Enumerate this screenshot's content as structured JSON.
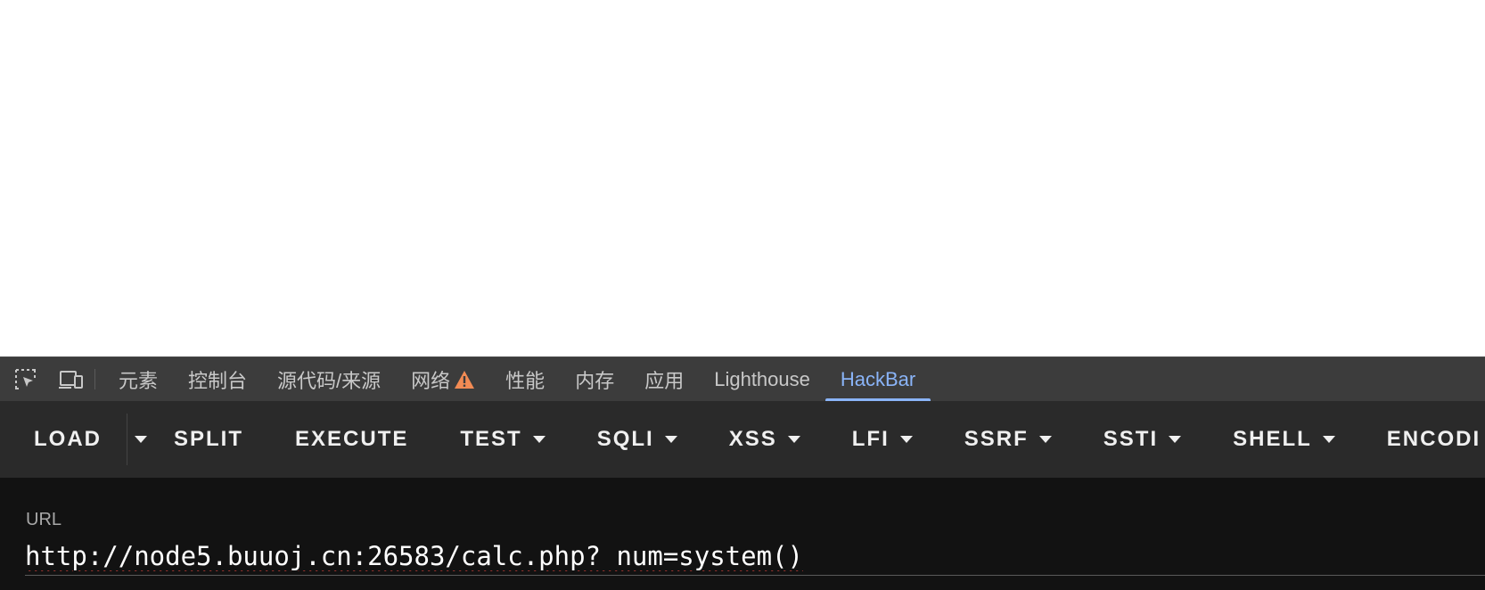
{
  "devtools": {
    "tabs": [
      {
        "label": "元素"
      },
      {
        "label": "控制台"
      },
      {
        "label": "源代码/来源"
      },
      {
        "label": "网络",
        "warning": true
      },
      {
        "label": "性能"
      },
      {
        "label": "内存"
      },
      {
        "label": "应用"
      },
      {
        "label": "Lighthouse"
      },
      {
        "label": "HackBar",
        "active": true
      }
    ],
    "active_tab_color": "#8ab4f8",
    "warning_color": "#f28b54"
  },
  "hackbar": {
    "buttons": {
      "load": "LOAD",
      "split": "SPLIT",
      "execute": "EXECUTE",
      "test": "TEST",
      "sqli": "SQLI",
      "xss": "XSS",
      "lfi": "LFI",
      "ssrf": "SSRF",
      "ssti": "SSTI",
      "shell": "SHELL",
      "encoding": "ENCODI"
    },
    "url_label": "URL",
    "url_value": "http://node5.buuoj.cn:26583/calc.php? num=system()"
  }
}
